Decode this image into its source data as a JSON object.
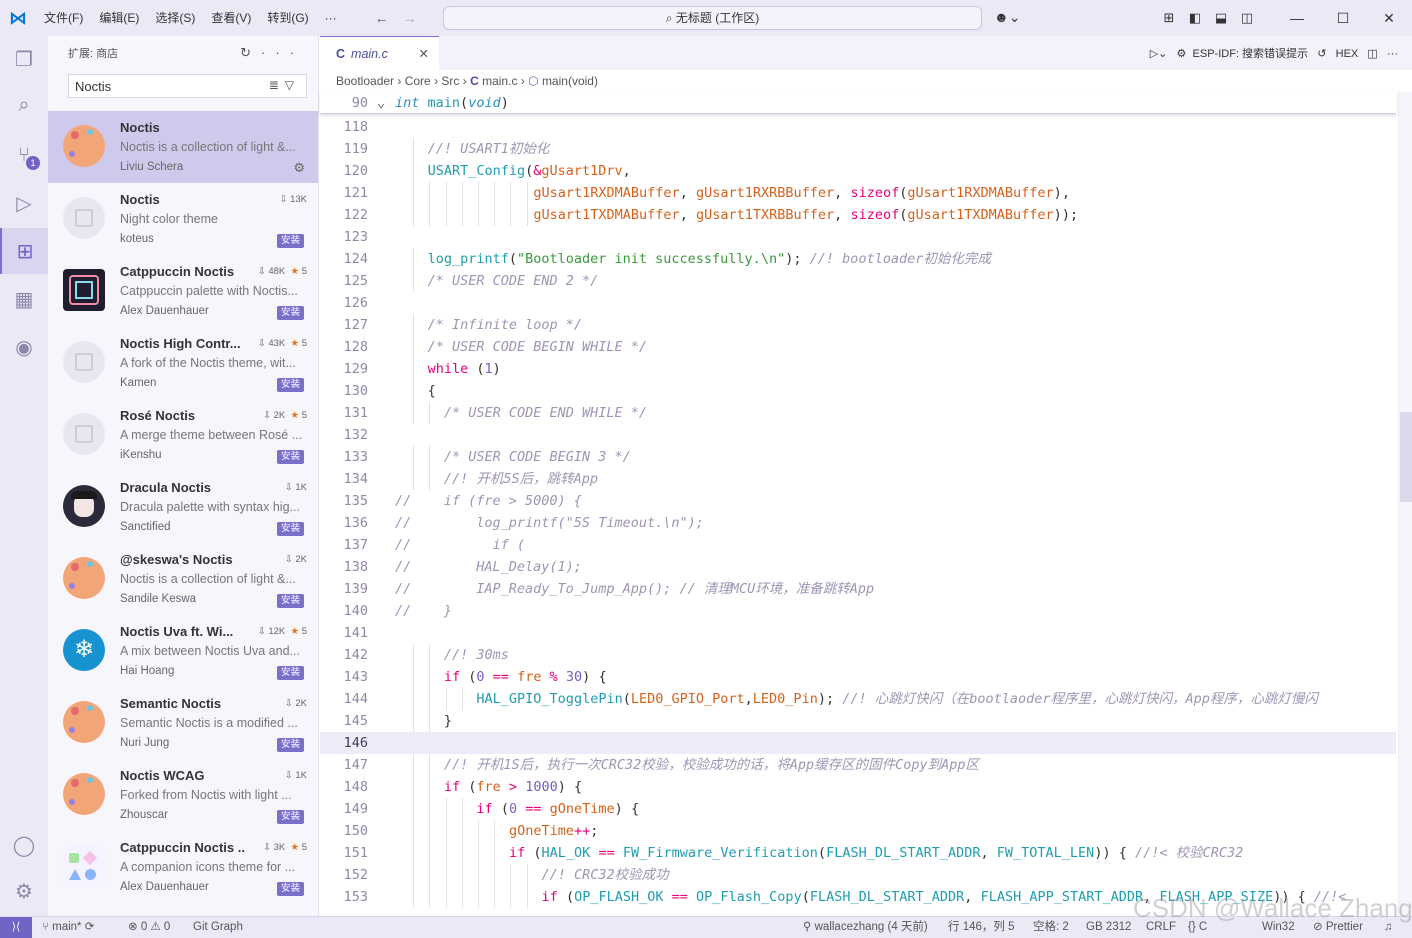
{
  "titlebar": {
    "menus": [
      "文件(F)",
      "编辑(E)",
      "选择(S)",
      "查看(V)",
      "转到(G)",
      "···"
    ],
    "search": "无标题 (工作区)"
  },
  "activity": {
    "source_control_badge": "1"
  },
  "sidebar": {
    "title": "扩展: 商店",
    "search_value": "Noctis",
    "extensions": [
      {
        "name": "Noctis",
        "desc": "Noctis is a collection of light &...",
        "publisher": "Liviu Schera",
        "downloads": "",
        "stars": "",
        "installed": true,
        "icon_color": "#f2a678",
        "icon_kind": "dots"
      },
      {
        "name": "Noctis",
        "desc": "Night color theme",
        "publisher": "koteus",
        "downloads": "13K",
        "stars": "",
        "install_label": "安装",
        "icon_color": "#e8e6ee",
        "icon_kind": "plain"
      },
      {
        "name": "Catppuccin Noctis",
        "desc": "Catppuccin palette with Noctis...",
        "publisher": "Alex Dauenhauer",
        "downloads": "48K",
        "stars": "5",
        "install_label": "安装",
        "icon_color": "#1e1e2e",
        "icon_kind": "square"
      },
      {
        "name": "Noctis High Contr...",
        "desc": "A fork of the Noctis theme, wit...",
        "publisher": "Kamen",
        "downloads": "43K",
        "stars": "5",
        "install_label": "安装",
        "icon_color": "#e8e6ee",
        "icon_kind": "plain"
      },
      {
        "name": "Rosé Noctis",
        "desc": "A merge theme between Rosé ...",
        "publisher": "iKenshu",
        "downloads": "2K",
        "stars": "5",
        "install_label": "安装",
        "icon_color": "#e8e6ee",
        "icon_kind": "plain"
      },
      {
        "name": "Dracula Noctis",
        "desc": "Dracula palette with syntax hig...",
        "publisher": "Sanctified",
        "downloads": "1K",
        "stars": "",
        "install_label": "安装",
        "icon_color": "#2b2a3a",
        "icon_kind": "dracula"
      },
      {
        "name": "@skeswa's Noctis",
        "desc": "Noctis is a collection of light &...",
        "publisher": "Sandile Keswa",
        "downloads": "2K",
        "stars": "",
        "install_label": "安装",
        "icon_color": "#f2a678",
        "icon_kind": "dots"
      },
      {
        "name": "Noctis Uva ft. Wi...",
        "desc": "A mix between Noctis Uva and...",
        "publisher": "Hai Hoang",
        "downloads": "12K",
        "stars": "5",
        "install_label": "安装",
        "icon_color": "#1793d1",
        "icon_kind": "snow"
      },
      {
        "name": "Semantic Noctis",
        "desc": "Semantic Noctis is a modified ...",
        "publisher": "Nuri Jung",
        "downloads": "2K",
        "stars": "",
        "install_label": "安装",
        "icon_color": "#f2a678",
        "icon_kind": "dots"
      },
      {
        "name": "Noctis WCAG",
        "desc": "Forked from Noctis with light ...",
        "publisher": "Zhouscar",
        "downloads": "1K",
        "stars": "",
        "install_label": "安装",
        "icon_color": "#f2a678",
        "icon_kind": "dots"
      },
      {
        "name": "Catppuccin Noctis ...",
        "desc": "A companion icons theme for ...",
        "publisher": "Alex Dauenhauer",
        "downloads": "3K",
        "stars": "5",
        "install_label": "安装",
        "icon_color": "#f5f3ff",
        "icon_kind": "shapes"
      }
    ]
  },
  "editor": {
    "tab": "main.c",
    "tab_actions": "ESP-IDF: 搜索错误提示",
    "hex_label": "HEX",
    "breadcrumb": [
      "Bootloader",
      "Core",
      "Src",
      "main.c",
      "main(void)"
    ],
    "sticky": {
      "num": "90",
      "text": "int main(void)"
    },
    "lines": [
      {
        "n": "118",
        "t": ""
      },
      {
        "n": "119",
        "t": "    //! USART1初始化"
      },
      {
        "n": "120",
        "t": "    USART_Config(&gUsart1Drv,"
      },
      {
        "n": "121",
        "t": "                 gUsart1RXDMABuffer, gUsart1RXRBBuffer, sizeof(gUsart1RXDMABuffer),"
      },
      {
        "n": "122",
        "t": "                 gUsart1TXDMABuffer, gUsart1TXRBBuffer, sizeof(gUsart1TXDMABuffer));"
      },
      {
        "n": "123",
        "t": ""
      },
      {
        "n": "124",
        "t": "    log_printf(\"Bootloader init successfully.\\n\"); //! bootloader初始化完成"
      },
      {
        "n": "125",
        "t": "    /* USER CODE END 2 */"
      },
      {
        "n": "126",
        "t": ""
      },
      {
        "n": "127",
        "t": "    /* Infinite loop */"
      },
      {
        "n": "128",
        "t": "    /* USER CODE BEGIN WHILE */"
      },
      {
        "n": "129",
        "t": "    while (1)"
      },
      {
        "n": "130",
        "t": "    {"
      },
      {
        "n": "131",
        "t": "      /* USER CODE END WHILE */"
      },
      {
        "n": "132",
        "t": ""
      },
      {
        "n": "133",
        "t": "      /* USER CODE BEGIN 3 */"
      },
      {
        "n": "134",
        "t": "      //! 开机5S后，跳转App"
      },
      {
        "n": "135",
        "t": "//    if (fre > 5000) {"
      },
      {
        "n": "136",
        "t": "//        log_printf(\"5S Timeout.\\n\");"
      },
      {
        "n": "137",
        "t": "//          if ("
      },
      {
        "n": "138",
        "t": "//        HAL_Delay(1);"
      },
      {
        "n": "139",
        "t": "//        IAP_Ready_To_Jump_App(); // 清理MCU环境，准备跳转App"
      },
      {
        "n": "140",
        "t": "//    }"
      },
      {
        "n": "141",
        "t": ""
      },
      {
        "n": "142",
        "t": "      //! 30ms"
      },
      {
        "n": "143",
        "t": "      if (0 == fre % 30) {"
      },
      {
        "n": "144",
        "t": "          HAL_GPIO_TogglePin(LED0_GPIO_Port,LED0_Pin); //! 心跳灯快闪（在bootlaoder程序里，心跳灯快闪，App程序，心跳灯慢闪"
      },
      {
        "n": "145",
        "t": "      }"
      },
      {
        "n": "146",
        "t": ""
      },
      {
        "n": "147",
        "t": "      //! 开机1S后，执行一次CRC32校验，校验成功的话，将App缓存区的固件Copy到App区"
      },
      {
        "n": "148",
        "t": "      if (fre > 1000) {"
      },
      {
        "n": "149",
        "t": "          if (0 == gOneTime) {"
      },
      {
        "n": "150",
        "t": "              gOneTime++;"
      },
      {
        "n": "151",
        "t": "              if (HAL_OK == FW_Firmware_Verification(FLASH_DL_START_ADDR, FW_TOTAL_LEN)) { //!< 校验CRC32"
      },
      {
        "n": "152",
        "t": "                  //! CRC32校验成功"
      },
      {
        "n": "153",
        "t": "                  if (OP_FLASH_OK == OP_Flash_Copy(FLASH_DL_START_ADDR, FLASH_APP_START_ADDR, FLASH_APP_SIZE)) { //!<"
      }
    ]
  },
  "statusbar": {
    "branch": "main*",
    "problems": "⊗ 0 ⚠ 0",
    "git_graph": "Git Graph",
    "blame": "wallacezhang (4 天前)",
    "position": "行 146，列 5",
    "spaces": "空格: 2",
    "encoding": "GB 2312",
    "eol": "CRLF",
    "lang": "{} C",
    "platform": "Win32",
    "prettier": "Prettier"
  },
  "watermark": "CSDN @Wallace Zhang"
}
